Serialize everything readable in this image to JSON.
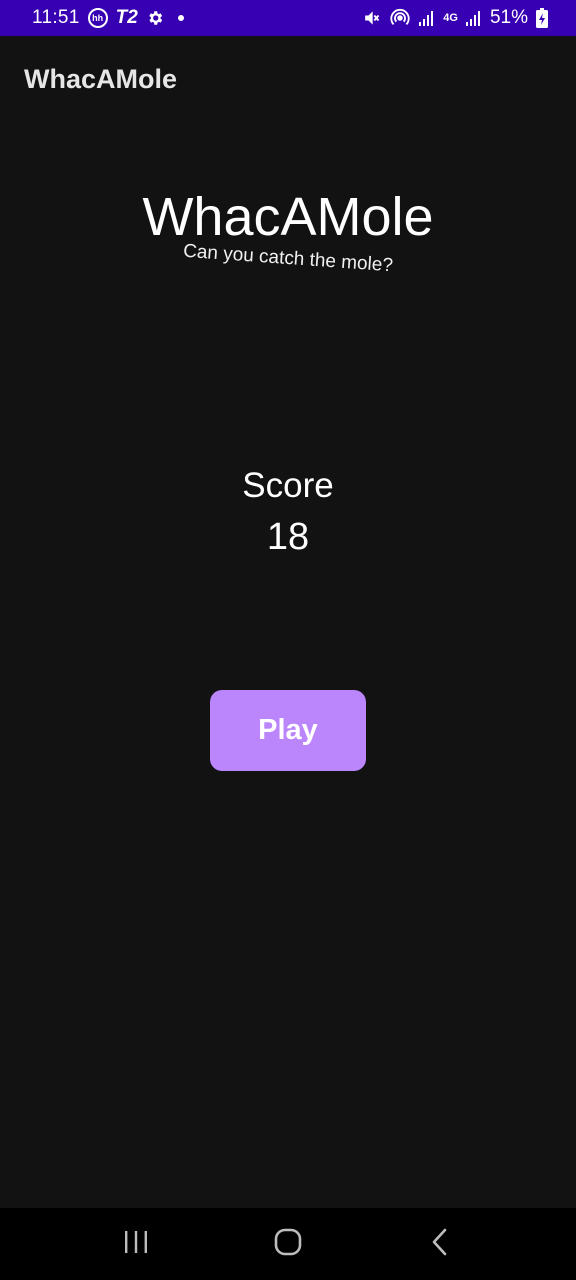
{
  "status_bar": {
    "time": "11:51",
    "left_icons": [
      "hh-icon",
      "t2-icon",
      "gear-icon",
      "dot-icon"
    ],
    "hh_text": "hh",
    "t2_text": "T2",
    "right_icons": [
      "mute-icon",
      "hotspot-icon",
      "signal-icon",
      "data-4g-icon",
      "signal-icon"
    ],
    "network_text": "4G",
    "battery_text": "51%"
  },
  "app_bar": {
    "title": "WhacAMole"
  },
  "main": {
    "title": "WhacAMole",
    "tagline": "Can you catch the mole?",
    "score_label": "Score",
    "score_value": "18",
    "play_label": "Play"
  },
  "nav_bar": {
    "buttons": [
      "recents-icon",
      "home-icon",
      "back-icon"
    ]
  },
  "colors": {
    "status_bar": "#3700b3",
    "background": "#121212",
    "accent": "#bb86fc",
    "nav_bar": "#000000"
  }
}
